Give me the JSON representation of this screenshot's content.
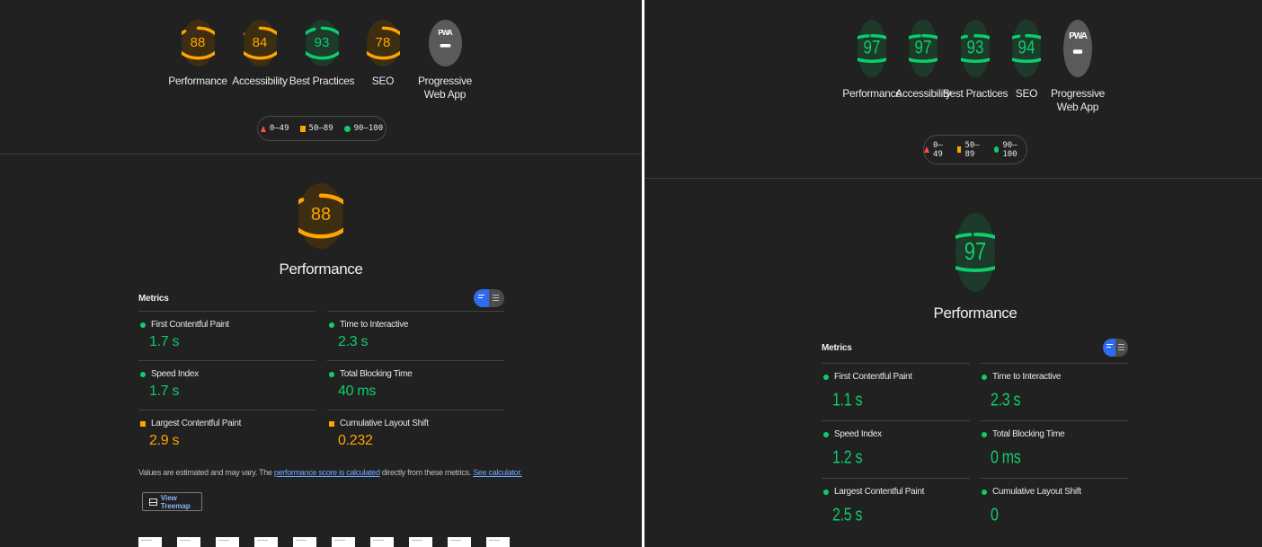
{
  "legend": {
    "fail": "0–49",
    "average": "50–89",
    "pass": "90–100"
  },
  "left": {
    "categories": [
      {
        "label": "Performance",
        "score": "88",
        "value": 88,
        "status": "average"
      },
      {
        "label": "Accessibility",
        "score": "84",
        "value": 84,
        "status": "average"
      },
      {
        "label": "Best Practices",
        "score": "93",
        "value": 93,
        "status": "pass"
      },
      {
        "label": "SEO",
        "score": "78",
        "value": 78,
        "status": "average"
      },
      {
        "label": "Progressive\nWeb App",
        "score": "PWA",
        "value": 0,
        "status": "pwa"
      }
    ],
    "main": {
      "score": "88",
      "value": 88,
      "status": "average",
      "title": "Performance"
    },
    "metrics_title": "Metrics",
    "metrics": [
      {
        "name": "First Contentful Paint",
        "value": "1.7 s",
        "status": "pass"
      },
      {
        "name": "Time to Interactive",
        "value": "2.3 s",
        "status": "pass"
      },
      {
        "name": "Speed Index",
        "value": "1.7 s",
        "status": "pass"
      },
      {
        "name": "Total Blocking Time",
        "value": "40 ms",
        "status": "pass"
      },
      {
        "name": "Largest Contentful Paint",
        "value": "2.9 s",
        "status": "average"
      },
      {
        "name": "Cumulative Layout Shift",
        "value": "0.232",
        "status": "average"
      }
    ],
    "note": {
      "prefix": "Values are estimated and may vary. The ",
      "link1": "performance score is calculated",
      "middle": " directly from these metrics. ",
      "link2": "See calculator."
    },
    "treemap_label": "View Treemap"
  },
  "right": {
    "categories": [
      {
        "label": "Performance",
        "score": "97",
        "value": 97,
        "status": "pass"
      },
      {
        "label": "Accessibility",
        "score": "97",
        "value": 97,
        "status": "pass"
      },
      {
        "label": "Best Practices",
        "score": "93",
        "value": 93,
        "status": "pass"
      },
      {
        "label": "SEO",
        "score": "94",
        "value": 94,
        "status": "pass"
      },
      {
        "label": "Progressive\nWeb App",
        "score": "PWA",
        "value": 0,
        "status": "pwa"
      }
    ],
    "main": {
      "score": "97",
      "value": 97,
      "status": "pass",
      "title": "Performance"
    },
    "metrics_title": "Metrics",
    "metrics": [
      {
        "name": "First Contentful Paint",
        "value": "1.1 s",
        "status": "pass"
      },
      {
        "name": "Time to Interactive",
        "value": "2.3 s",
        "status": "pass"
      },
      {
        "name": "Speed Index",
        "value": "1.2 s",
        "status": "pass"
      },
      {
        "name": "Total Blocking Time",
        "value": "0 ms",
        "status": "pass"
      },
      {
        "name": "Largest Contentful Paint",
        "value": "2.5 s",
        "status": "pass"
      },
      {
        "name": "Cumulative Layout Shift",
        "value": "0",
        "status": "pass"
      }
    ]
  },
  "colors": {
    "pass": "#0cce6b",
    "average": "#ffa400",
    "fail": "#ff4e42",
    "panel": "#212121",
    "toggle_on": "#2e6bf0"
  }
}
